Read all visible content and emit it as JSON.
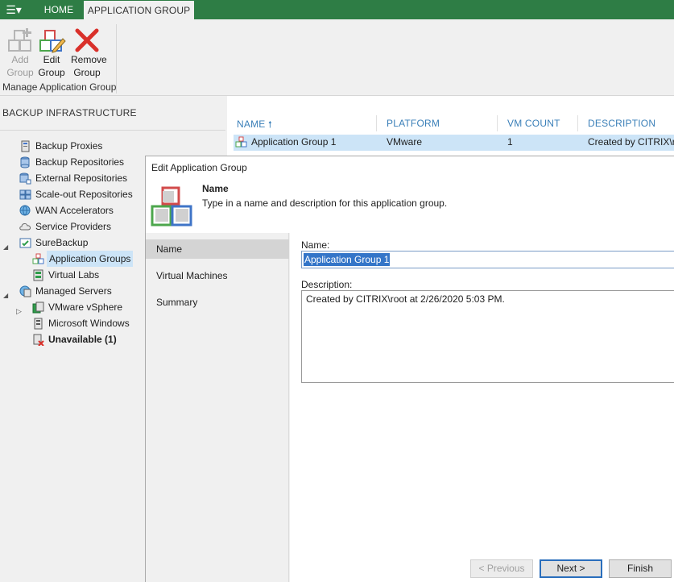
{
  "tabs": {
    "menu_glyph": "☰▾",
    "home": "HOME",
    "application_group": "APPLICATION GROUP"
  },
  "ribbon": {
    "add_group": [
      "Add",
      "Group"
    ],
    "edit_group": [
      "Edit",
      "Group"
    ],
    "remove_group": [
      "Remove",
      "Group"
    ],
    "group_label": "Manage Application Group"
  },
  "left": {
    "header": "BACKUP INFRASTRUCTURE",
    "tree": {
      "backup_proxies": "Backup Proxies",
      "backup_repositories": "Backup Repositories",
      "external_repositories": "External Repositories",
      "scaleout_repositories": "Scale-out Repositories",
      "wan_accelerators": "WAN Accelerators",
      "service_providers": "Service Providers",
      "surebackup": "SureBackup",
      "application_groups": "Application Groups",
      "virtual_labs": "Virtual Labs",
      "managed_servers": "Managed Servers",
      "vmware_vsphere": "VMware vSphere",
      "microsoft_windows": "Microsoft Windows",
      "unavailable": "Unavailable (1)"
    }
  },
  "list": {
    "columns": {
      "name": "NAME",
      "sort_arrow": "🠕",
      "platform": "PLATFORM",
      "vm_count": "VM COUNT",
      "description": "DESCRIPTION"
    },
    "row": {
      "name": "Application Group 1",
      "platform": "VMware",
      "vm_count": "1",
      "description": "Created by CITRIX\\root"
    }
  },
  "dialog": {
    "title": "Edit Application Group",
    "header_title": "Name",
    "header_desc": "Type in a name and description for this application group.",
    "steps": {
      "name": "Name",
      "virtual_machines": "Virtual Machines",
      "summary": "Summary"
    },
    "name_label": "Name:",
    "name_value": "Application Group 1",
    "description_label": "Description:",
    "description_value": "Created by CITRIX\\root at 2/26/2020 5:03 PM.",
    "buttons": {
      "previous": "< Previous",
      "next": "Next >",
      "finish": "Finish"
    }
  },
  "colors": {
    "ribbon_green": "#2e7d45",
    "selection": "#cce4f7",
    "header_blue": "#3a7fb8"
  }
}
